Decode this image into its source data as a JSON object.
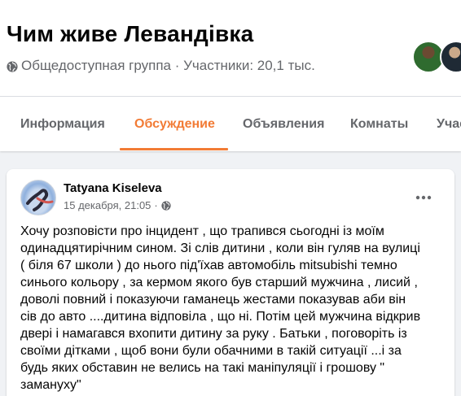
{
  "group": {
    "title": "Чим живе Левандівка",
    "meta": "Общедоступная группа · Участники: 20,1 тыс."
  },
  "tabs": [
    {
      "label": "Информация",
      "active": false
    },
    {
      "label": "Обсуждение",
      "active": true
    },
    {
      "label": "Объявления",
      "active": false
    },
    {
      "label": "Комнаты",
      "active": false
    },
    {
      "label": "Учас",
      "active": false
    }
  ],
  "post": {
    "author": "Tatyana Kiseleva",
    "timestamp": "15 декабря, 21:05",
    "separator": "·",
    "text": "Хочу розповісти про інцидент , що трапився сьогодні із моїм\nодинадцятирічним  сином. Зі слів дитини , коли він гуляв на вулиці\n( біля 67 школи ) до нього під'їхав автомобіль  mitsubishi темно\nсинього кольору , за кермом якого був старший мужчина , лисий ,\nдоволі повний і показуючи гаманець жестами показував аби він\nсів до авто ....дитина відповіла , що ні. Потім цей мужчина відкрив\nдвері і намагався вхопити дитину за руку . Батьки , поговоріть із\nсвоїми дітками , щоб вони були обачними в такій ситуації ...і за\nбудь яких обставин не велись на такі маніпуляції і грошову  \"\nзамануху\""
  },
  "colors": {
    "accent": "#f27b35",
    "secondary_text": "#65676b",
    "background": "#f0f2f5"
  },
  "icons": {
    "globe": "globe-icon",
    "audience": "public-audience-icon",
    "more": "more-horizontal-icon"
  }
}
